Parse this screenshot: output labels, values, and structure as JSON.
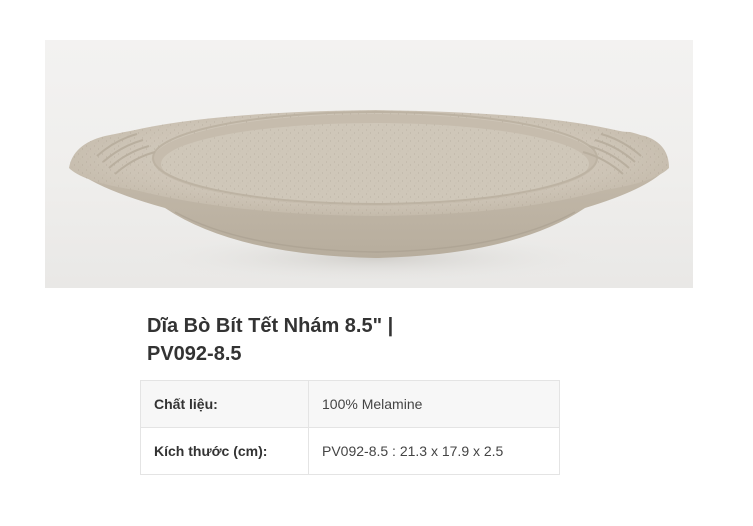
{
  "product": {
    "title_line1": "Dĩa Bò Bít Tết Nhám 8.5\" |",
    "title_line2": "PV092-8.5",
    "image_subject": "oval-plate-with-ridged-handles",
    "plate_color": "#cdc4b6",
    "background_color": "#f1f0ee"
  },
  "specs": [
    {
      "label": "Chất liệu:",
      "value": "100% Melamine"
    },
    {
      "label": "Kích thước (cm):",
      "value": "PV092-8.5 : 21.3 x 17.9 x 2.5"
    }
  ]
}
